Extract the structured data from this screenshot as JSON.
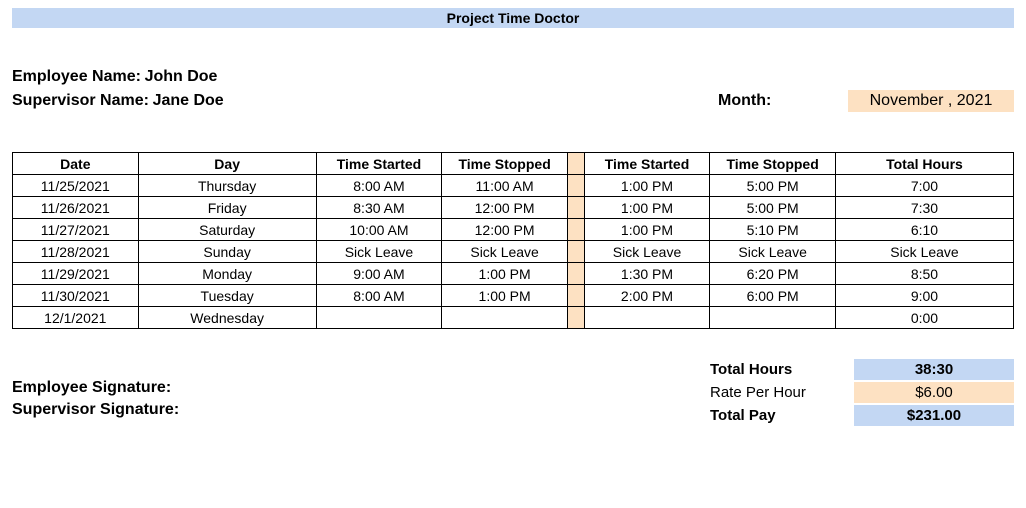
{
  "title": "Project Time Doctor",
  "info": {
    "employee_label": "Employee Name:",
    "employee_name": "John Doe",
    "supervisor_label": "Supervisor Name:",
    "supervisor_name": "Jane Doe",
    "month_label": "Month:",
    "month_value": "November , 2021"
  },
  "columns": {
    "date": "Date",
    "day": "Day",
    "ts1_start": "Time Started",
    "ts1_stop": "Time Stopped",
    "ts2_start": "Time Started",
    "ts2_stop": "Time Stopped",
    "total": "Total Hours"
  },
  "rows": [
    {
      "date": "11/25/2021",
      "day": "Thursday",
      "s1": "8:00 AM",
      "e1": "11:00 AM",
      "s2": "1:00 PM",
      "e2": "5:00 PM",
      "total": "7:00"
    },
    {
      "date": "11/26/2021",
      "day": "Friday",
      "s1": "8:30 AM",
      "e1": "12:00 PM",
      "s2": "1:00 PM",
      "e2": "5:00 PM",
      "total": "7:30"
    },
    {
      "date": "11/27/2021",
      "day": "Saturday",
      "s1": "10:00 AM",
      "e1": "12:00 PM",
      "s2": "1:00 PM",
      "e2": "5:10 PM",
      "total": "6:10"
    },
    {
      "date": "11/28/2021",
      "day": "Sunday",
      "s1": "Sick Leave",
      "e1": "Sick Leave",
      "s2": "Sick Leave",
      "e2": "Sick Leave",
      "total": "Sick Leave"
    },
    {
      "date": "11/29/2021",
      "day": "Monday",
      "s1": "9:00 AM",
      "e1": "1:00 PM",
      "s2": "1:30 PM",
      "e2": "6:20 PM",
      "total": "8:50"
    },
    {
      "date": "11/30/2021",
      "day": "Tuesday",
      "s1": "8:00 AM",
      "e1": "1:00 PM",
      "s2": "2:00 PM",
      "e2": "6:00 PM",
      "total": "9:00"
    },
    {
      "date": "12/1/2021",
      "day": "Wednesday",
      "s1": "",
      "e1": "",
      "s2": "",
      "e2": "",
      "total": "0:00"
    }
  ],
  "signatures": {
    "employee": "Employee Signature:",
    "supervisor": "Supervisor Signature:"
  },
  "totals": {
    "total_hours_label": "Total Hours",
    "total_hours_value": "38:30",
    "rate_label": "Rate Per Hour",
    "rate_value": "$6.00",
    "pay_label": "Total Pay",
    "pay_value": "$231.00"
  }
}
